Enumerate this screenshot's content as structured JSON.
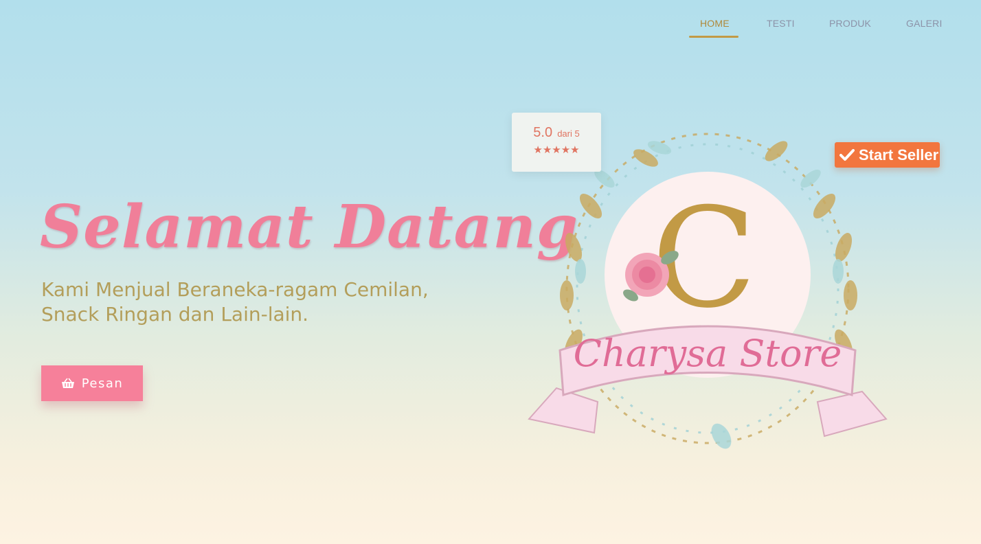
{
  "nav": {
    "items": [
      {
        "label": "HOME",
        "active": true
      },
      {
        "label": "TESTI",
        "active": false
      },
      {
        "label": "PRODUK",
        "active": false
      },
      {
        "label": "GALERI",
        "active": false
      }
    ]
  },
  "hero": {
    "title": "Selamat Datang",
    "subtitle": "Kami Menjual Beraneka-ragam Cemilan, Snack Ringan dan Lain-lain.",
    "cta_label": "Pesan",
    "cta_icon": "basket-icon"
  },
  "rating": {
    "value": "5.0",
    "suffix": "dari 5",
    "stars": 5,
    "stars_text": "★★★★★"
  },
  "badge": {
    "label": "Start Seller",
    "icon": "check-icon"
  },
  "logo": {
    "letter": "C",
    "name": "Charysa Store"
  },
  "colors": {
    "accent_pink": "#f6809a",
    "gold": "#b0893a",
    "badge_orange": "#f2763e",
    "star_color": "#e07461"
  }
}
